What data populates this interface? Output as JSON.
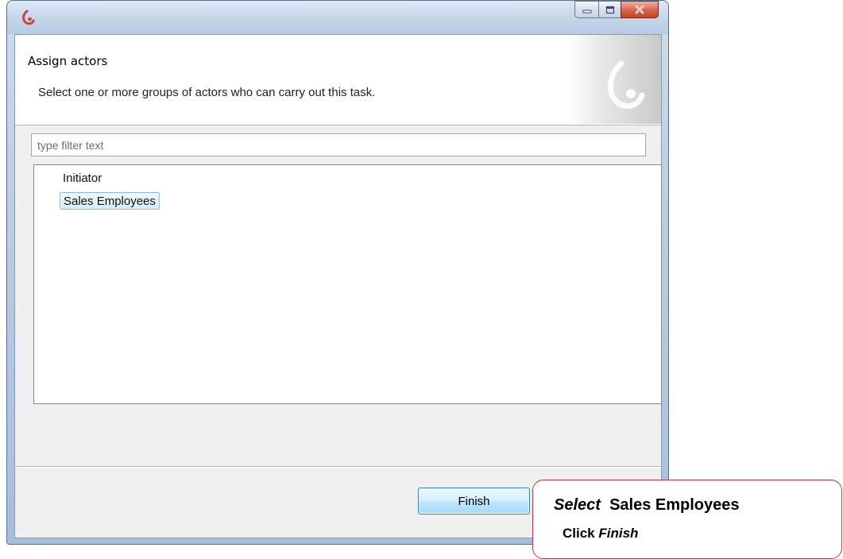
{
  "window": {
    "title": "",
    "controls": {
      "minimize": "minimize",
      "maximize": "maximize",
      "close": "close"
    }
  },
  "header": {
    "title": "Assign actors",
    "description": "Select one or more groups of actors who can carry out this task."
  },
  "filter": {
    "placeholder": "type filter text",
    "value": ""
  },
  "actors": {
    "items": [
      {
        "label": "Initiator",
        "selected": false
      },
      {
        "label": "Sales Employees",
        "selected": true
      }
    ]
  },
  "buttons": {
    "finish_label": "Finish"
  },
  "callout": {
    "line1_action": "Select",
    "line1_target": "Sales Employees",
    "line2_action": "Click",
    "line2_target": "Finish"
  },
  "colors": {
    "accent": "#c8443f",
    "selection_border": "#84c0e8",
    "callout_border": "#b23a3a"
  },
  "icons": {
    "app": "bonita-logo-icon",
    "banner": "bonita-banner-logo-icon"
  }
}
